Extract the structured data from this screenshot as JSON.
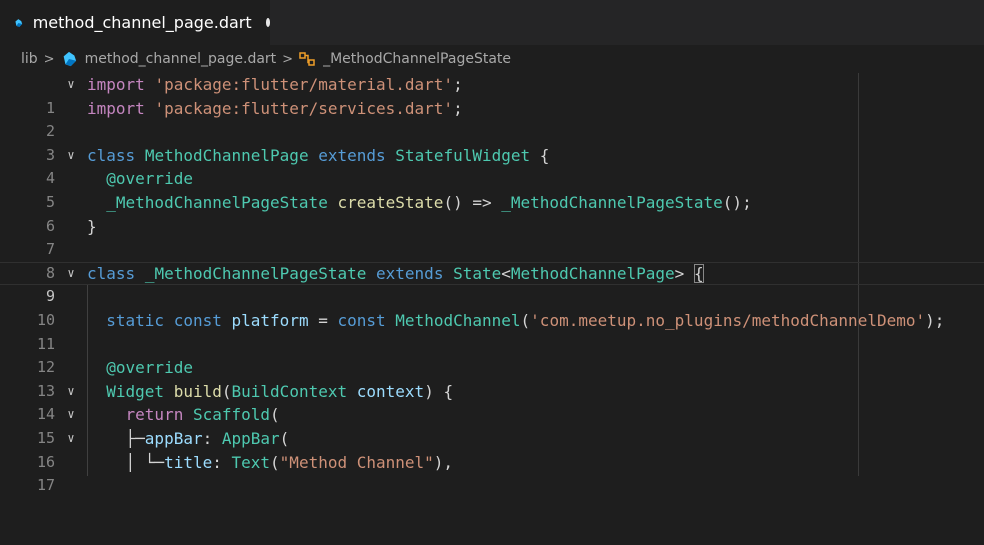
{
  "tab": {
    "title": "method_channel_page.dart",
    "icon": "dart-icon",
    "modified": true
  },
  "breadcrumb": {
    "root": "lib",
    "file": "method_channel_page.dart",
    "symbol": "_MethodChannelPageState",
    "symbol_icon": "class-icon"
  },
  "editor": {
    "current_line": 9,
    "lines": [
      {
        "n": "1",
        "fold": true
      },
      {
        "n": "2",
        "fold": false
      },
      {
        "n": "3",
        "fold": false
      },
      {
        "n": "4",
        "fold": true
      },
      {
        "n": "5",
        "fold": false
      },
      {
        "n": "6",
        "fold": false
      },
      {
        "n": "7",
        "fold": false
      },
      {
        "n": "8",
        "fold": false
      },
      {
        "n": "9",
        "fold": true
      },
      {
        "n": "10",
        "fold": false
      },
      {
        "n": "11",
        "fold": false
      },
      {
        "n": "12",
        "fold": false
      },
      {
        "n": "13",
        "fold": false
      },
      {
        "n": "14",
        "fold": true
      },
      {
        "n": "15",
        "fold": true
      },
      {
        "n": "16",
        "fold": true
      },
      {
        "n": "17",
        "fold": false
      }
    ],
    "tokens": {
      "import": "import",
      "pkg_material": "'package:flutter/material.dart'",
      "pkg_services": "'package:flutter/services.dart'",
      "semi": ";",
      "class": "class",
      "MethodChannelPage": "MethodChannelPage",
      "extends": "extends",
      "StatefulWidget": "StatefulWidget",
      "lbrace": "{",
      "rbrace": "}",
      "override": "@override",
      "state_type": "_MethodChannelPageState",
      "createState": "createState",
      "create_rest": "() => ",
      "call_end": "();",
      "State": "State",
      "lt": "<",
      "gt": ">",
      "static": "static",
      "const": "const",
      "platform": "platform",
      "eq": " = ",
      "MethodChannel": "MethodChannel",
      "channel_name": "'com.meetup.no_plugins/methodChannelDemo'",
      "paren_end": ");",
      "Widget": "Widget",
      "build": "build",
      "lparen": "(",
      "BuildContext": "BuildContext",
      "context": "context",
      "build_end": ") {",
      "return": "return",
      "Scaffold": "Scaffold",
      "appBar": "appBar",
      "colon": ": ",
      "AppBar": "AppBar",
      "title": "title",
      "Text": "Text",
      "title_str": "\"Method Channel\"",
      "text_end": "),",
      "guide1": "├─",
      "guide2a": "│ ",
      "guide2b": "└─"
    }
  }
}
